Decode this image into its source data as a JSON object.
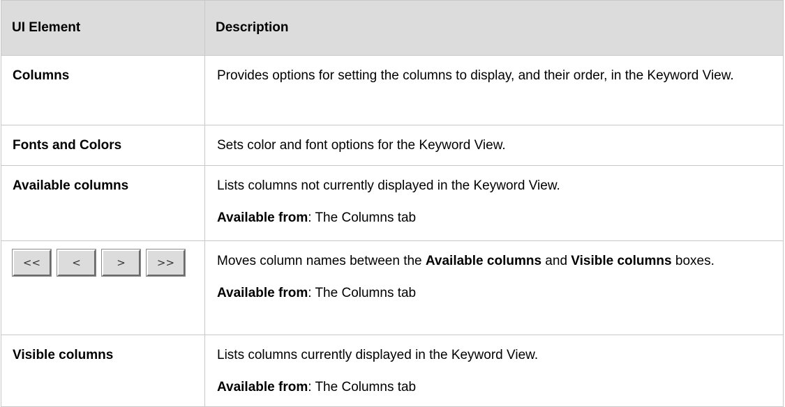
{
  "header": {
    "col_element": "UI Element",
    "col_description": "Description"
  },
  "rows": {
    "columns": {
      "element": "Columns",
      "description": "Provides options for setting the columns to display, and their order, in the Keyword View."
    },
    "fonts_colors": {
      "element": "Fonts and Colors",
      "description": "Sets color and font options for the Keyword View."
    },
    "available_columns": {
      "element": "Available columns",
      "description": "Lists columns not currently displayed in the Keyword View.",
      "avail_label": "Available from",
      "avail_value": ": The Columns tab"
    },
    "move_buttons": {
      "buttons": [
        "<<",
        "<",
        ">",
        ">>"
      ],
      "desc_pre": "Moves column names between the ",
      "desc_b1": "Available columns",
      "desc_mid": " and ",
      "desc_b2": "Visible columns",
      "desc_post": " boxes.",
      "avail_label": "Available from",
      "avail_value": ": The Columns tab"
    },
    "visible_columns": {
      "element": "Visible columns",
      "description": "Lists columns currently displayed in the Keyword View.",
      "avail_label": "Available from",
      "avail_value": ": The Columns tab"
    }
  }
}
